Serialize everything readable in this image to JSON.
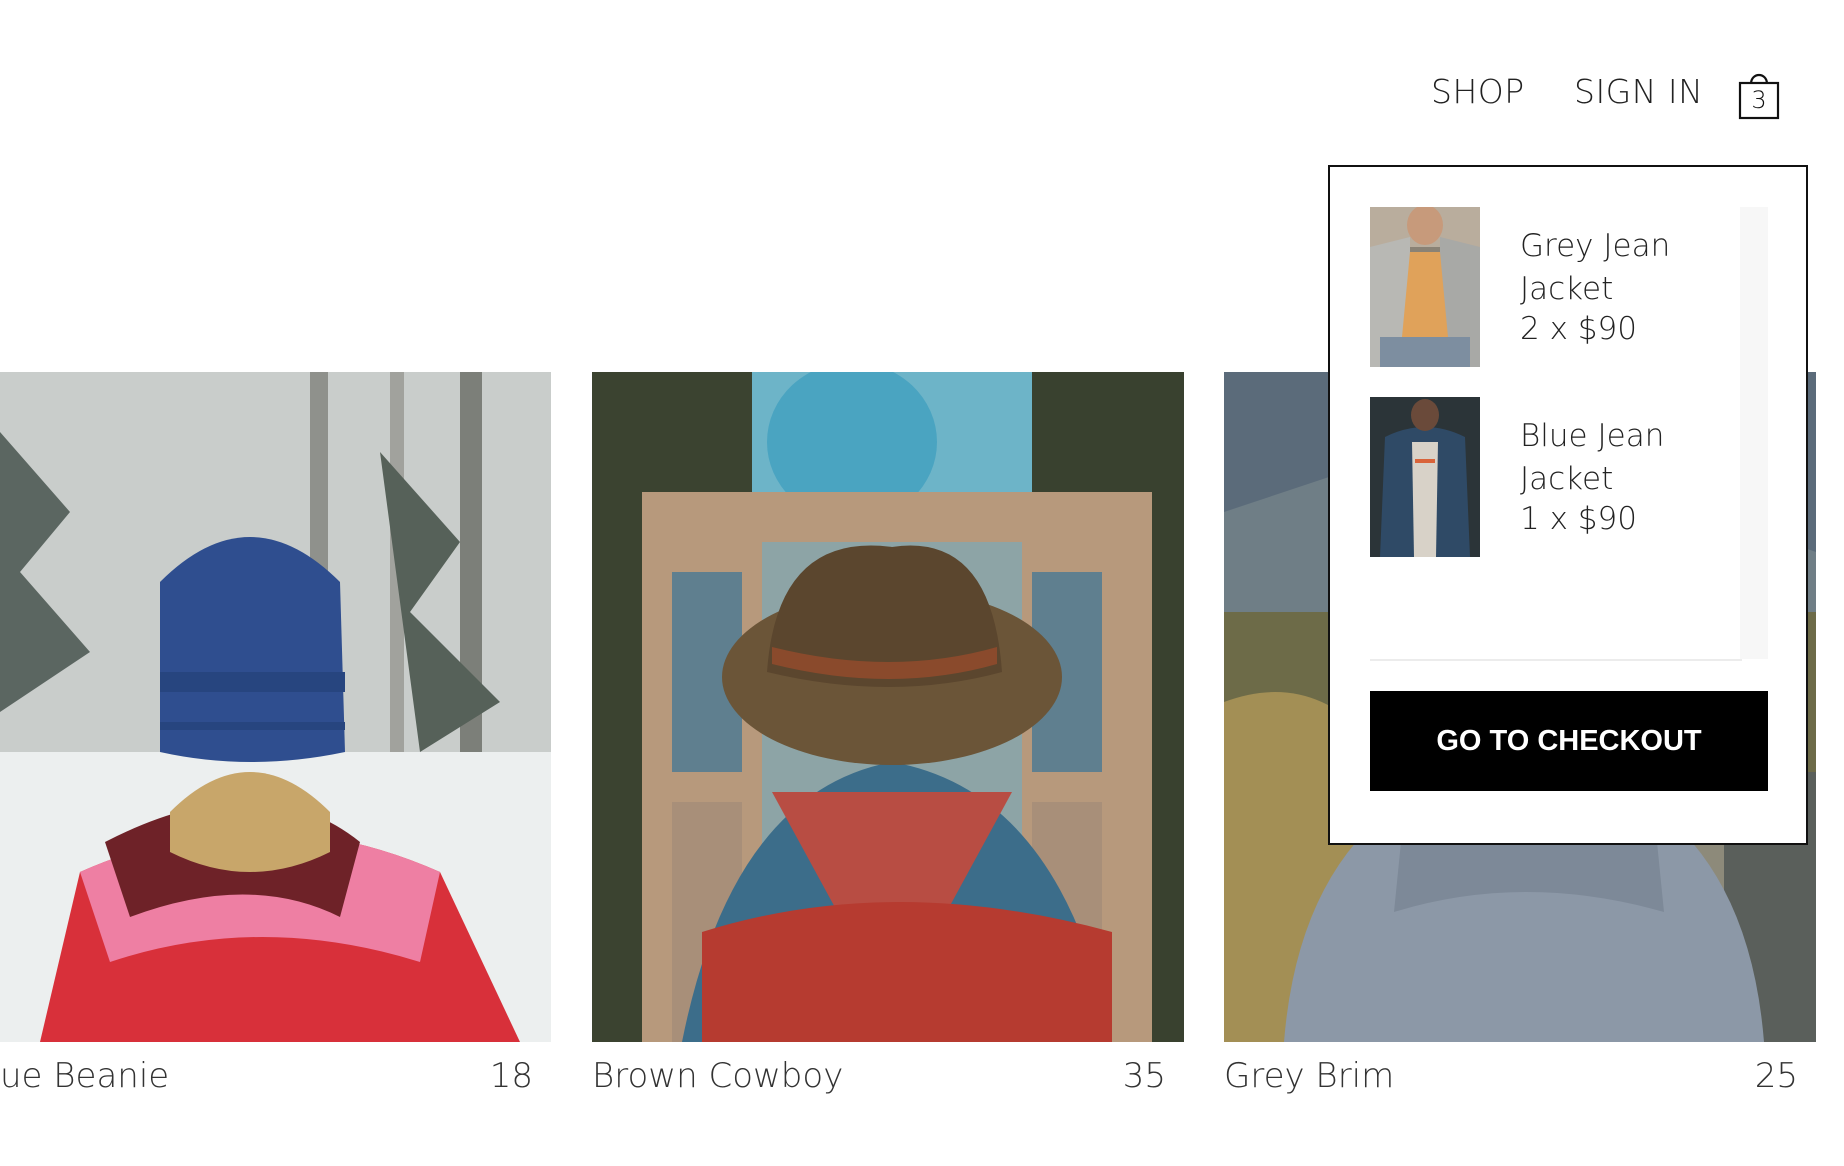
{
  "header": {
    "nav_shop": "SHOP",
    "nav_signin": "SIGN IN",
    "cart_count": "3"
  },
  "products": [
    {
      "name": "ue Beanie",
      "price": "18",
      "icon": "blue-beanie-photo"
    },
    {
      "name": "Brown Cowboy",
      "price": "35",
      "icon": "brown-cowboy-photo"
    },
    {
      "name": "Grey Brim",
      "price": "25",
      "icon": "grey-brim-photo"
    }
  ],
  "cart": {
    "items": [
      {
        "title": "Grey Jean Jacket",
        "qty": "2 x $90"
      },
      {
        "title": "Blue Jean Jacket",
        "qty": "1 x $90"
      }
    ],
    "checkout_label": "GO TO CHECKOUT"
  },
  "colors": {
    "checkout_bg": "#000000",
    "dropdown_border": "#111111",
    "text": "#222222"
  }
}
